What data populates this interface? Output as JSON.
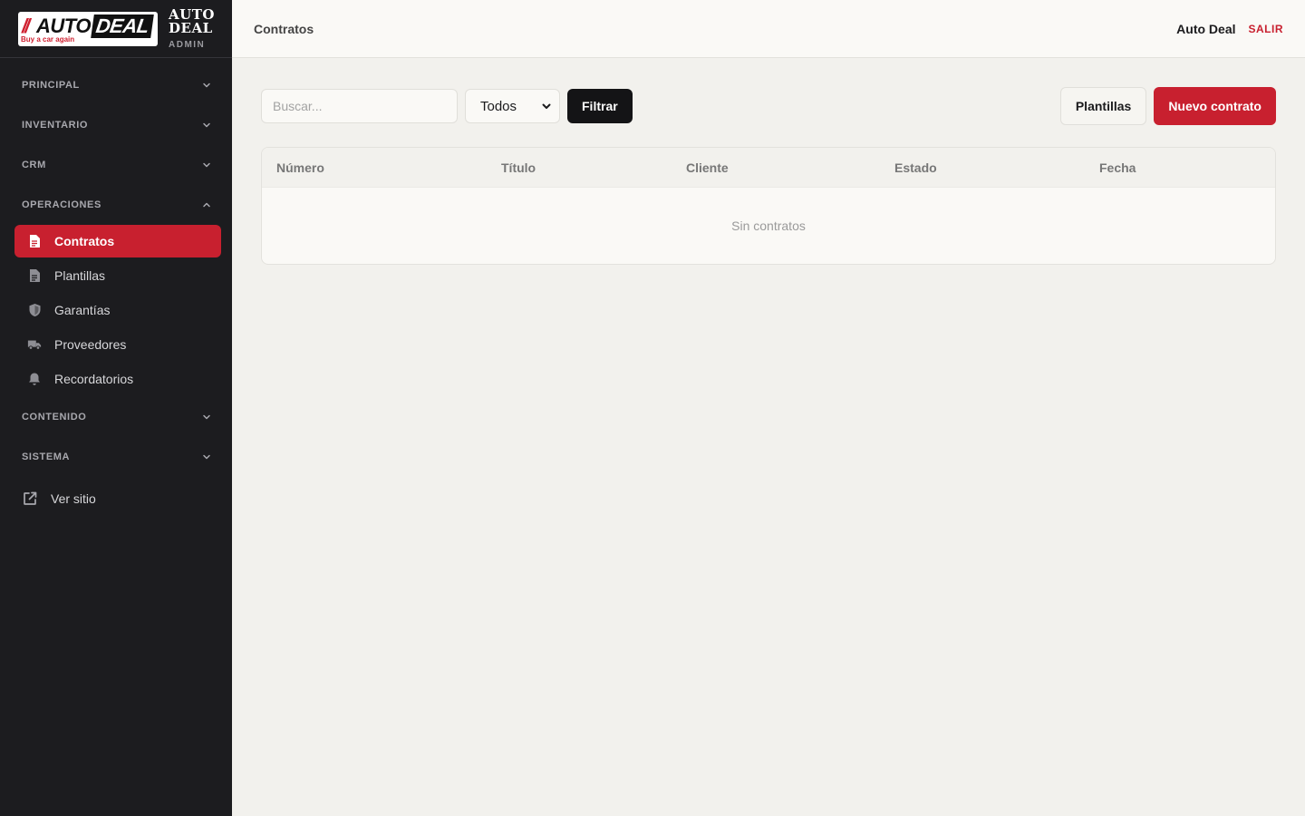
{
  "brand": {
    "logo_slash": "//",
    "logo_auto": "AUTO",
    "logo_deal": "DEAL",
    "logo_tagline": "Buy a car again",
    "name_line1": "AUTO",
    "name_line2": "DEAL",
    "admin_label": "ADMIN"
  },
  "sidebar": {
    "sections": [
      {
        "label": "PRINCIPAL",
        "expanded": false
      },
      {
        "label": "INVENTARIO",
        "expanded": false
      },
      {
        "label": "CRM",
        "expanded": false
      },
      {
        "label": "OPERACIONES",
        "expanded": true
      },
      {
        "label": "CONTENIDO",
        "expanded": false
      },
      {
        "label": "SISTEMA",
        "expanded": false
      }
    ],
    "operaciones_items": [
      {
        "label": "Contratos",
        "icon": "document-icon",
        "active": true
      },
      {
        "label": "Plantillas",
        "icon": "file-icon",
        "active": false
      },
      {
        "label": "Garantías",
        "icon": "shield-icon",
        "active": false
      },
      {
        "label": "Proveedores",
        "icon": "truck-icon",
        "active": false
      },
      {
        "label": "Recordatorios",
        "icon": "bell-icon",
        "active": false
      }
    ],
    "external_link": {
      "label": "Ver sitio",
      "icon": "external-link-icon"
    }
  },
  "topbar": {
    "title": "Contratos",
    "user_name": "Auto Deal",
    "logout_label": "SALIR"
  },
  "toolbar": {
    "search_placeholder": "Buscar...",
    "status_filter_value": "Todos",
    "filter_button": "Filtrar",
    "templates_button": "Plantillas",
    "new_button": "Nuevo contrato"
  },
  "table": {
    "columns": [
      "Número",
      "Título",
      "Cliente",
      "Estado",
      "Fecha"
    ],
    "rows": [],
    "empty_message": "Sin contratos"
  },
  "colors": {
    "accent": "#c8202f",
    "sidebar_bg": "#1c1c1f",
    "page_bg": "#f2f1ed"
  }
}
